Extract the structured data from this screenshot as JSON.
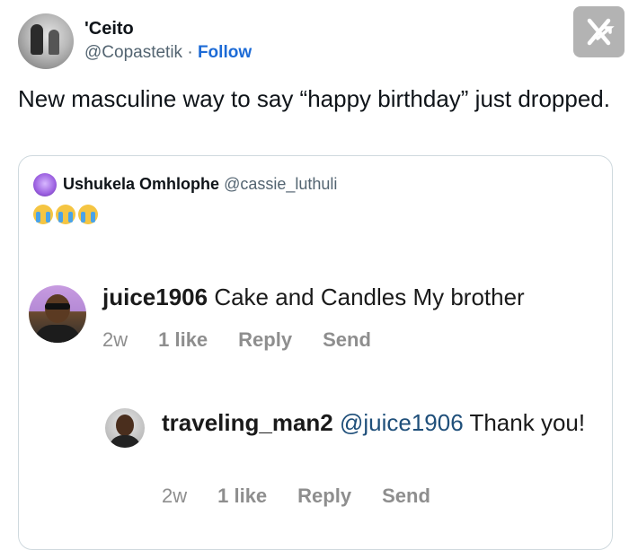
{
  "tweet": {
    "author_name": "'Ceito",
    "author_handle": "@Copastetik",
    "separator": " · ",
    "follow_label": "Follow",
    "text": "New masculine way to say “happy birthday” just dropped."
  },
  "x_logo_icon": "x-logo-icon",
  "quoted": {
    "author_name": "Ushukela Omhlophe",
    "author_handle": "@cassie_luthuli",
    "emoji_icon": "crying-face-icon",
    "emoji_count": 3
  },
  "comments": [
    {
      "username": "juice1906",
      "text": " Cake and Candles My brother",
      "time": "2w",
      "likes": "1 like",
      "reply_label": "Reply",
      "send_label": "Send"
    },
    {
      "username": "traveling_man2",
      "mention": "@juice1906",
      "text": " Thank you!",
      "time": "2w",
      "likes": "1 like",
      "reply_label": "Reply",
      "send_label": "Send"
    }
  ],
  "colors": {
    "follow": "#1d6bd6",
    "mention": "#1f4f7a",
    "meta_gray": "#8e8e8e",
    "card_border": "#cfd9de"
  }
}
